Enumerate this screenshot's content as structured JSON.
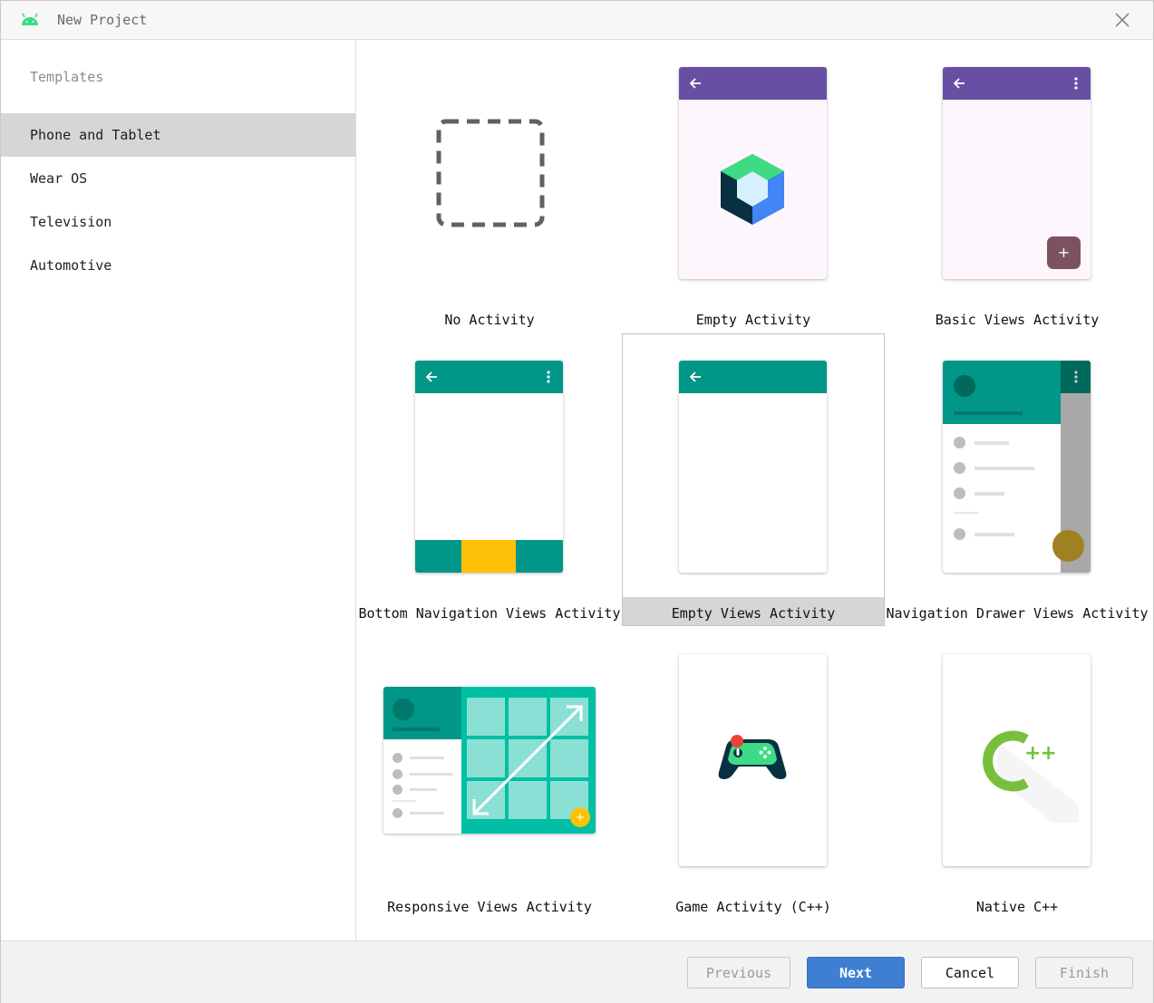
{
  "window": {
    "title": "New Project",
    "app_icon": "android-icon",
    "close_icon": "close-icon"
  },
  "sidebar": {
    "header": "Templates",
    "items": [
      {
        "label": "Phone and Tablet",
        "selected": true
      },
      {
        "label": "Wear OS",
        "selected": false
      },
      {
        "label": "Television",
        "selected": false
      },
      {
        "label": "Automotive",
        "selected": false
      }
    ]
  },
  "templates": [
    {
      "label": "No Activity",
      "selected": false
    },
    {
      "label": "Empty Activity",
      "selected": false
    },
    {
      "label": "Basic Views Activity",
      "selected": false
    },
    {
      "label": "Bottom Navigation Views Activity",
      "selected": false
    },
    {
      "label": "Empty Views Activity",
      "selected": true
    },
    {
      "label": "Navigation Drawer Views Activity",
      "selected": false
    },
    {
      "label": "Responsive Views Activity",
      "selected": false
    },
    {
      "label": "Game Activity (C++)",
      "selected": false
    },
    {
      "label": "Native C++",
      "selected": false
    }
  ],
  "icons": {
    "plus": "+",
    "cpp": "++"
  },
  "footer": {
    "previous": "Previous",
    "next": "Next",
    "cancel": "Cancel",
    "finish": "Finish"
  },
  "colors": {
    "purple_appbar": "#6750a4",
    "teal_appbar": "#009688",
    "amber": "#ffc107",
    "primary_button": "#3f7fd1",
    "selected_bg": "#d6d6d6"
  }
}
